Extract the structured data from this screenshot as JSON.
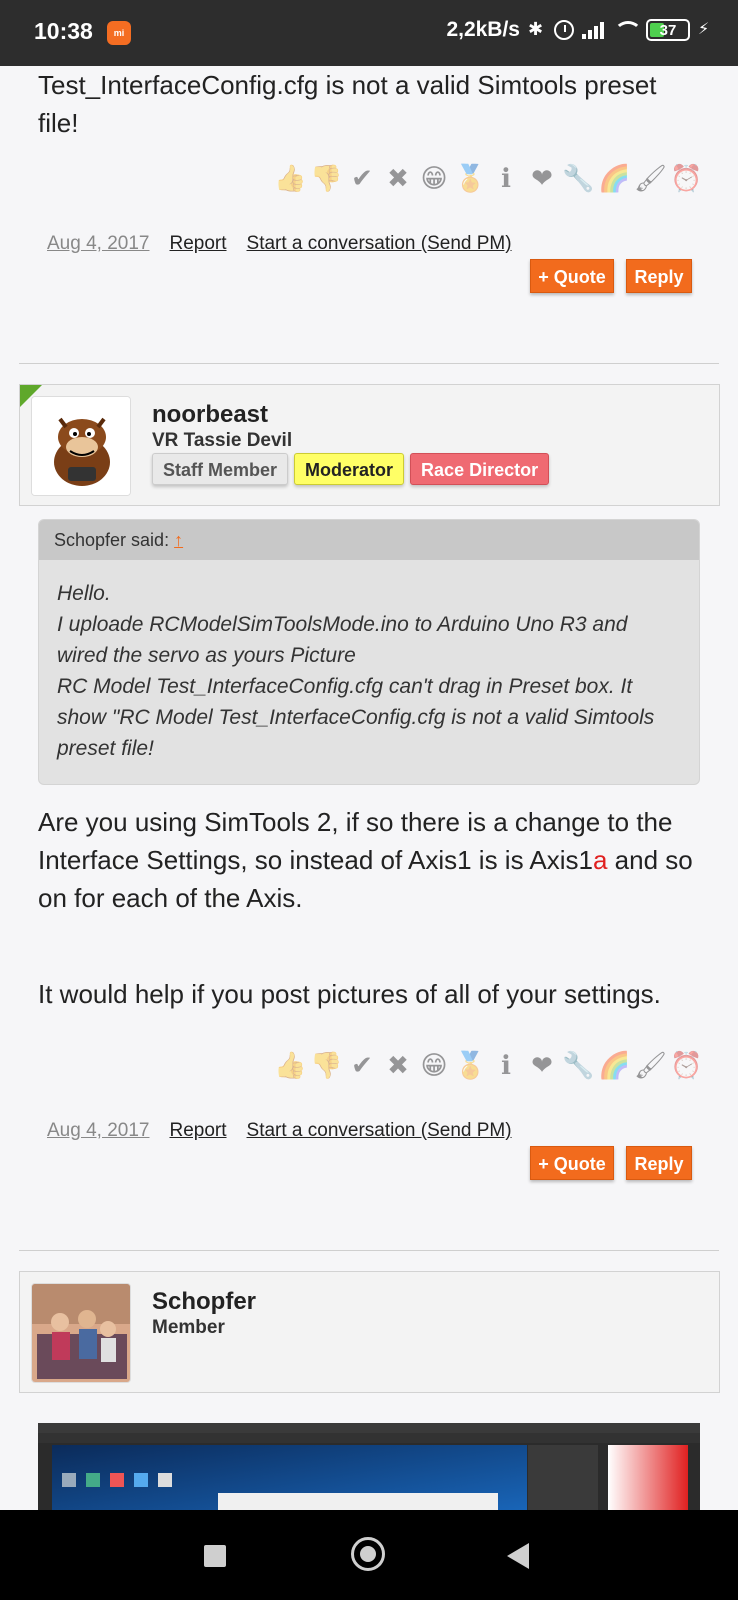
{
  "status_bar": {
    "time": "10:38",
    "notification_icon": "mi-app-icon",
    "net_speed": "2,2kB/s",
    "battery": "37",
    "icons": [
      "bluetooth-icon",
      "alarm-icon",
      "signal-icon",
      "wifi-icon",
      "battery-icon",
      "charging-icon"
    ]
  },
  "post1": {
    "text": "Test_InterfaceConfig.cfg is not a valid Simtools preset file!",
    "date": "Aug 4, 2017",
    "report": "Report",
    "conversation": "Start a conversation (Send PM)",
    "quote_btn": "+ Quote",
    "reply_btn": "Reply"
  },
  "reactions": [
    "👍",
    "👎",
    "✔",
    "✖",
    "😁",
    "🏅",
    "ℹ",
    "❤",
    "🔧",
    "🌈",
    "🖌",
    "⏰"
  ],
  "user1": {
    "name": "noorbeast",
    "title": "VR Tassie Devil",
    "badges": {
      "staff": "Staff Member",
      "moderator": "Moderator",
      "race": "Race Director"
    }
  },
  "post2": {
    "quote_author": "Schopfer said:",
    "quote_arrow": "↑",
    "quote_lines": [
      "Hello.",
      "I uploade RCModelSimToolsMode.ino to Arduino Uno R3 and",
      "wired the servo as yours Picture",
      "RC Model Test_InterfaceConfig.cfg can't drag in Preset box. It",
      "show \"RC Model Test_InterfaceConfig.cfg is not a valid Simtools",
      "preset file!"
    ],
    "body_part1": "Are you using SimTools 2, if so there is a change to the Interface Settings, so instead of Axis1 is is Axis1",
    "body_highlight": "a",
    "body_part2": " and so on for each of the Axis.",
    "body_para2": "It would help if you post pictures of all of your settings.",
    "date": "Aug 4, 2017",
    "report": "Report",
    "conversation": "Start a conversation (Send PM)",
    "quote_btn": "+ Quote",
    "reply_btn": "Reply"
  },
  "user2": {
    "name": "Schopfer",
    "title": "Member"
  },
  "colors": {
    "accent": "#f26b1d",
    "highlight_red": "#e02020",
    "moderator_badge": "#ffff66",
    "race_badge": "#ef6a72"
  }
}
